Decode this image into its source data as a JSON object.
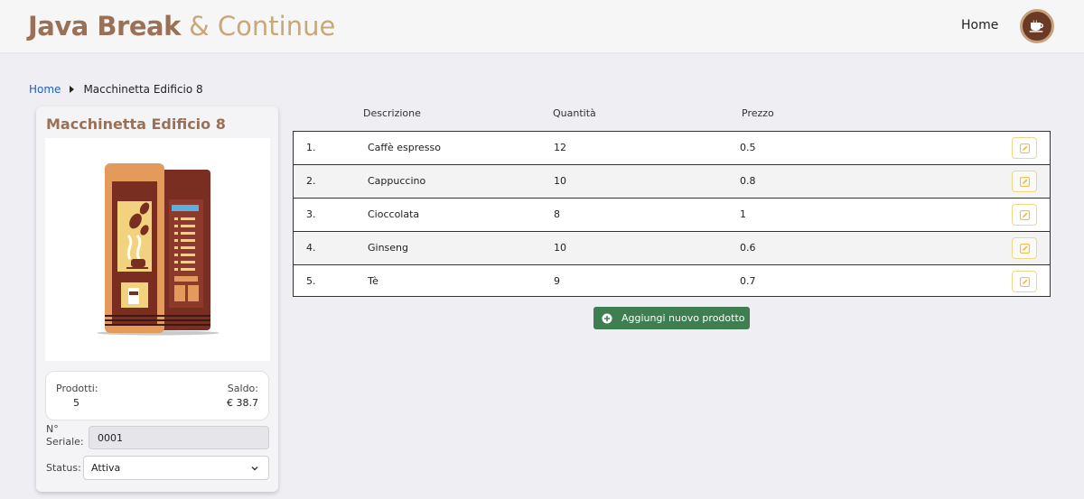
{
  "header": {
    "logo_bold": "Java Break",
    "logo_light": "& Continue",
    "nav_home": "Home",
    "avatar_icon": "coffee-cup-icon"
  },
  "breadcrumb": {
    "home": "Home",
    "current": "Macchinetta Edificio 8"
  },
  "machine": {
    "title": "Macchinetta Edificio 8",
    "image_icon": "vending-machine-illustration",
    "products_label": "Prodotti:",
    "products_value": "5",
    "balance_label": "Saldo:",
    "balance_value": "€ 38.7",
    "serial_label": "N° Seriale:",
    "serial_value": "0001",
    "status_label": "Status:",
    "status_value": "Attiva"
  },
  "table": {
    "headers": {
      "description": "Descrizione",
      "quantity": "Quantità",
      "price": "Prezzo"
    },
    "rows": [
      {
        "num": "1.",
        "description": "Caffè espresso",
        "quantity": "12",
        "price": "0.5"
      },
      {
        "num": "2.",
        "description": "Cappuccino",
        "quantity": "10",
        "price": "0.8"
      },
      {
        "num": "3.",
        "description": "Cioccolata",
        "quantity": "8",
        "price": "1"
      },
      {
        "num": "4.",
        "description": "Ginseng",
        "quantity": "10",
        "price": "0.6"
      },
      {
        "num": "5.",
        "description": "Tè",
        "quantity": "9",
        "price": "0.7"
      }
    ]
  },
  "add_button_label": "Aggiungi nuovo prodotto",
  "colors": {
    "brand_brown": "#9a7157",
    "brand_tan": "#c9a878",
    "add_button_green": "#3e7e50",
    "edit_button_border": "#f0d58a",
    "link_blue": "#1f5fbf"
  }
}
